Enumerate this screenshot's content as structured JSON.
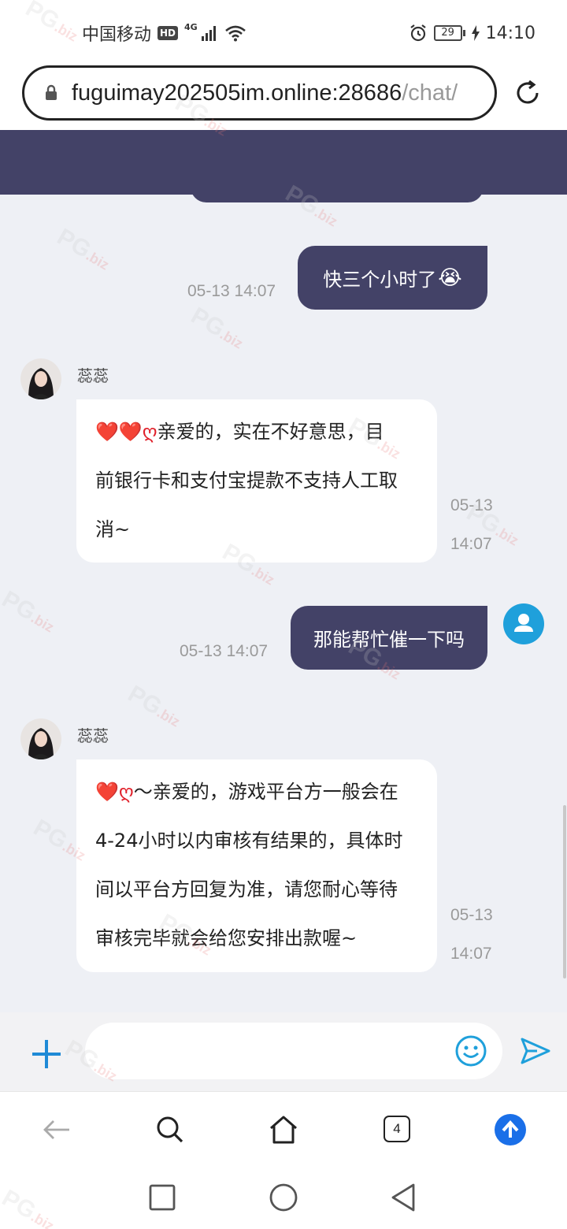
{
  "status_bar": {
    "carrier": "中国移动",
    "hd_badge": "HD",
    "network": "4G",
    "battery": "29",
    "time": "14:10"
  },
  "browser": {
    "url_main": "fuguimay202505im.online:28686",
    "url_path": "/chat/",
    "tab_count": "4"
  },
  "chat": {
    "messages": [
      {
        "direction": "out",
        "text": "快三个小时了",
        "emoji": "😭",
        "time": "05-13 14:07"
      },
      {
        "direction": "in",
        "sender": "蕊蕊",
        "lines": [
          "亲爱的，实在不好意思，目",
          "前银行卡和支付宝提款不支持人工取",
          "消~"
        ],
        "prefix": "❤️❤️ღ",
        "time_date": "05-13",
        "time_clock": "14:07"
      },
      {
        "direction": "out",
        "text": "那能帮忙催一下吗",
        "time": "05-13 14:07"
      },
      {
        "direction": "in",
        "sender": "蕊蕊",
        "lines": [
          "～亲爱的，游戏平台方一般会在",
          "4-24小时以内审核有结果的，具体时",
          "间以平台方回复为准，请您耐心等待",
          "审核完毕就会给您安排出款喔~"
        ],
        "prefix": "❤️ღ",
        "time_date": "05-13",
        "time_clock": "14:07"
      }
    ]
  },
  "input": {
    "placeholder": "",
    "value": ""
  },
  "colors": {
    "theme": "#434267",
    "chat_bg": "#eef0f5",
    "accent": "#1fa0db"
  }
}
